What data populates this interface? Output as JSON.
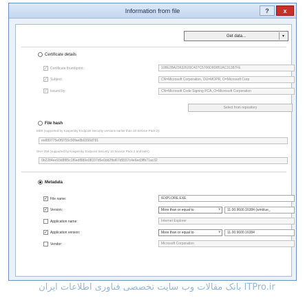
{
  "window": {
    "title": "Information from file",
    "help_label": "?",
    "close_label": "x"
  },
  "get_data": {
    "label": "Get data...",
    "arrow": "▾"
  },
  "certificate": {
    "label": "Certificate details",
    "thumbprint_label": "Certificate thumbprint:",
    "thumbprint_value": "108E2BA23632620C427C5706D9D851AC31387FE",
    "subject_label": "Subject:",
    "subject_value": "CN=Microsoft Corporation, OU=MOPR, O=Microsoft Corp",
    "issued_label": "Issued by:",
    "issued_value": "CN=Microsoft Code Signing PCA, O=Microsoft Corporation",
    "repo_button": "Select from repository"
  },
  "file_hash": {
    "label": "File hash",
    "md5_note": "MD5 (supported by Kaspersky Endpoint Security versions earlier than 10 Service Pack 2):",
    "md5_value": "ee889775e0f9755c90fae8b9356d781",
    "sha_note": "SHA-256 (supported by Kaspersky Endpoint Security 10 Service Pack 2 and later):",
    "sha_value": "0b2284ee93d8f85c1f6edf889e08337d5e0dd2fbd67d5557c4e6ed3ffb71ac32"
  },
  "metadata": {
    "label": "Metadata",
    "file_name_label": "File name:",
    "file_name_value": "IEXPLORE.EXE",
    "version_label": "Version:",
    "version_op": "More than or equal to",
    "version_value": "11.00.9600.16384 (winblue_",
    "app_name_label": "Application name:",
    "app_name_value": "Internet Explorer",
    "app_version_label": "Application version:",
    "app_version_op": "More than or equal to",
    "app_version_value": "11.00.9600.16384",
    "vendor_label": "Vendor:",
    "vendor_value": "Microsoft Corporation"
  },
  "watermark": {
    "text": "بانک مقالات وب سایت تخصصی فناوری اطلاعات ایران ITPro.ir"
  },
  "colors": {
    "accent": "#c9302c",
    "frame": "#eaf1fb"
  },
  "icons": {
    "check": "✓",
    "combo_arrow": "v"
  }
}
